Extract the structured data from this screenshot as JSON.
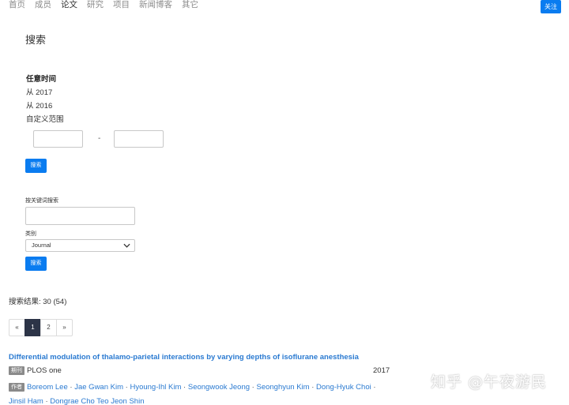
{
  "nav": {
    "items": [
      "首页",
      "成员",
      "论文",
      "研究",
      "项目",
      "新闻博客",
      "其它"
    ],
    "active_index": 2,
    "follow_label": "关注"
  },
  "search": {
    "title": "搜索",
    "time_heading": "任意时间",
    "time_options": [
      "从 2017",
      "从 2016",
      "自定义范围"
    ],
    "range_separator": "-",
    "search_button": "搜索",
    "keyword_label": "按关键词搜索",
    "category_label": "类别",
    "category_value": "Journal",
    "search_button_2": "搜索"
  },
  "results": {
    "summary": "搜索结果: 30 (54)"
  },
  "pager": {
    "prev": "«",
    "pages": [
      "1",
      "2"
    ],
    "current": "1",
    "next": "»"
  },
  "paper": {
    "title": "Differential modulation of thalamo-parietal interactions by varying depths of isoflurane anesthesia",
    "journal_tag": "期刊",
    "journal": "PLOS one",
    "year": "2017",
    "authors_tag": "作者",
    "authors": [
      "Boreom Lee",
      "Jae Gwan Kim",
      "Hyoung-Ihl Kim",
      "Seongwook Jeong",
      "Seonghyun Kim",
      "Dong-Hyuk Choi",
      "Jinsil Ham",
      "Dongrae Cho",
      "Teo",
      "Jeon Shin"
    ]
  },
  "watermark": "知乎 @午夜游民",
  "colors": {
    "accent": "#0a7cf0",
    "link": "#2a7ad1",
    "pager_active": "#2c3447"
  }
}
